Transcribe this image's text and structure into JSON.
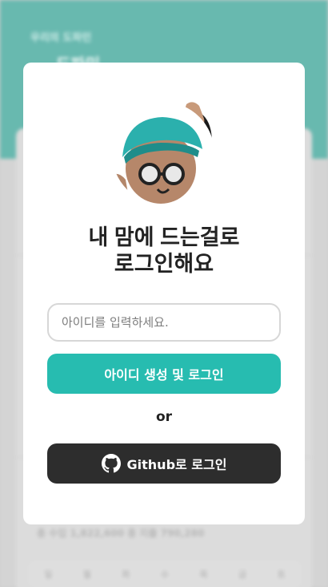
{
  "background": {
    "header_subtitle": "우리의 도파민",
    "header_title": "도파민",
    "stats_text": "총 수입 1,822,600  총 지출 790,280",
    "weekdays": [
      "일",
      "월",
      "화",
      "수",
      "목",
      "금",
      "토"
    ]
  },
  "modal": {
    "title_line1": "내 맘에 드는걸로",
    "title_line2": "로그인해요",
    "id_input": {
      "placeholder": "아이디를 입력하세요.",
      "value": ""
    },
    "create_button_label": "아이디 생성 및 로그인",
    "or_label": "or",
    "github_button_label": "Github로 로그인"
  },
  "colors": {
    "accent": "#27bcb0",
    "dark_button": "#2d2d2d",
    "header_bg": "#2f9e91"
  },
  "icons": {
    "avatar": "waving-character-avatar",
    "github": "github-icon"
  }
}
